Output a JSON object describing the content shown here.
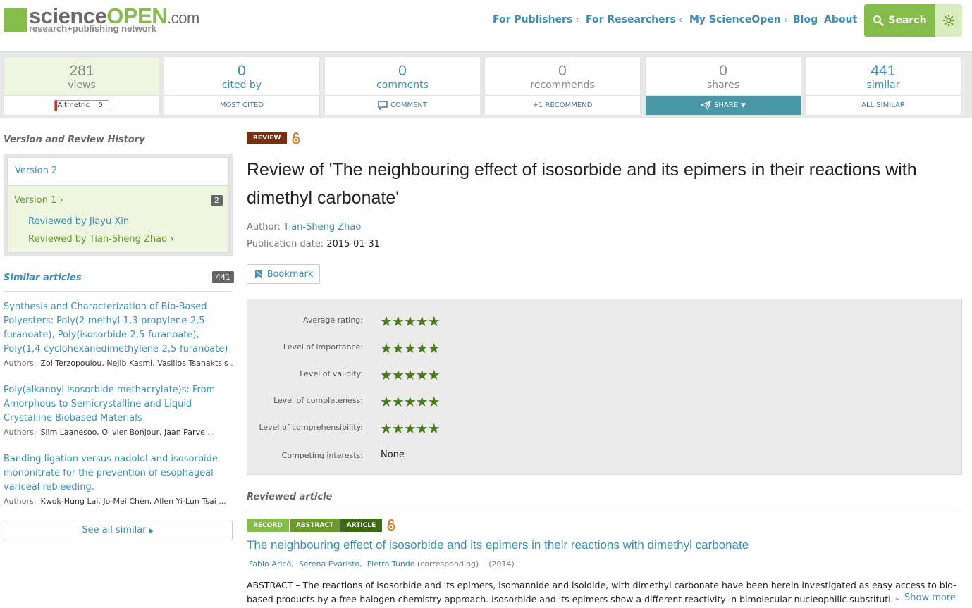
{
  "header": {
    "logo_science": "science",
    "logo_open": "OPEN",
    "logo_dotcom": ".com",
    "logo_tagline": "research+publishing network",
    "nav": [
      {
        "label": "For Publishers",
        "dropdown": true
      },
      {
        "label": "For Researchers",
        "dropdown": true
      },
      {
        "label": "My ScienceOpen",
        "dropdown": true
      },
      {
        "label": "Blog",
        "dropdown": false
      },
      {
        "label": "About",
        "dropdown": false
      }
    ],
    "search_label": "Search"
  },
  "stats": [
    {
      "value": "281",
      "label": "views",
      "footer": "altmetric"
    },
    {
      "value": "0",
      "label": "cited by",
      "footer": "MOST CITED"
    },
    {
      "value": "0",
      "label": "comments",
      "footer": "COMMENT"
    },
    {
      "value": "0",
      "label": "recommends",
      "footer": "+1 RECOMMEND"
    },
    {
      "value": "0",
      "label": "shares",
      "footer": "SHARE"
    },
    {
      "value": "441",
      "label": "similar",
      "footer": "ALL SIMILAR"
    }
  ],
  "altmetric": {
    "label": "Altmetric",
    "score": "0"
  },
  "sidebar": {
    "history_title": "Version and Review History",
    "version2": "Version 2",
    "version1": "Version 1",
    "version1_count": "2",
    "reviews": [
      "Reviewed by Jiayu Xin",
      "Reviewed by Tian-Sheng Zhao"
    ],
    "similar_title": "Similar articles",
    "similar_count": "441",
    "similar_items": [
      {
        "title": "Synthesis and Characterization of Bio-Based Polyesters: Poly(2-methyl-1,3-propylene-2,5-furanoate), Poly(isosorbide-2,5-furanoate), Poly(1,4-cyclohexanedimethylene-2,5-furanoate)",
        "authors_label": "Authors:",
        "authors": "Zoi Terzopoulou,  Nejib Kasmi,  Vasilios Tsanaktsis ..."
      },
      {
        "title": "Poly(alkanoyl isosorbide methacrylate)s: From Amorphous to Semicrystalline and Liquid Crystalline Biobased Materials",
        "authors_label": "Authors:",
        "authors": "Siim Laanesoo,  Olivier Bonjour,  Jaan Parve ..."
      },
      {
        "title": "Banding ligation versus nadolol and isosorbide mononitrate for the prevention of esophageal variceal rebleeding.",
        "authors_label": "Authors:",
        "authors": "Kwok-Hung Lai,  Jo-Mei Chen,  Allen Yi-Lun Tsai ..."
      }
    ],
    "see_all": "See all similar"
  },
  "main": {
    "badge": "REVIEW",
    "title": "Review of 'The neighbouring effect of isosorbide and its epimers in their reactions with dimethyl carbonate'",
    "author_label": "Author:",
    "author": "Tian-Sheng Zhao",
    "pubdate_label": "Publication date:",
    "pubdate": "2015-01-31",
    "bookmark": "Bookmark",
    "ratings": [
      {
        "label": "Average rating:",
        "stars": 5
      },
      {
        "label": "Level of importance:",
        "stars": 5
      },
      {
        "label": "Level of validity:",
        "stars": 5
      },
      {
        "label": "Level of completeness:",
        "stars": 5
      },
      {
        "label": "Level of comprehensibility:",
        "stars": 5
      }
    ],
    "competing_label": "Competing interests:",
    "competing_value": "None",
    "reviewed_title": "Reviewed article",
    "tags": [
      "RECORD",
      "ABSTRACT",
      "ARTICLE"
    ],
    "ref_title": "The neighbouring effect of isosorbide and its epimers in their reactions with dimethyl carbonate",
    "ref_authors": [
      "Fabio Aricò",
      "Serena Evaristo",
      "Pietro Tundo"
    ],
    "ref_corresponding": "(corresponding)",
    "ref_year": "(2014)",
    "abstract": "ABSTRACT – The reactions of isosorbide and its epimers, isomannide and isoidide, with dimethyl carbonate have been herein investigated as easy access to bio-based products by a free-halogen chemistry approach. Isosorbide and its epimers show a different reactivity in bimolecular nucleophilic substitution with DMC",
    "show_more": "Show more"
  },
  "colors": {
    "brand_green": "#86bd4a",
    "link_blue": "#3c8db8",
    "review_brown": "#7a2e0e",
    "star_green": "#4e7a1e",
    "share_teal": "#4a97a8"
  }
}
